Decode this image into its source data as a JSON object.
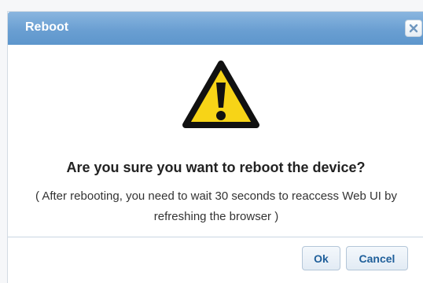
{
  "dialog": {
    "title": "Reboot",
    "question": "Are you sure you want to reboot the device?",
    "note": "( After rebooting, you need to wait 30 seconds to reaccess Web UI by refreshing the browser )",
    "ok_label": "Ok",
    "cancel_label": "Cancel",
    "icons": {
      "close": "close-icon",
      "warning": "warning-icon"
    }
  },
  "colors": {
    "titlebar": "#6a9fd2",
    "warning_fill": "#f7d417",
    "button_text": "#1f5f9a"
  }
}
